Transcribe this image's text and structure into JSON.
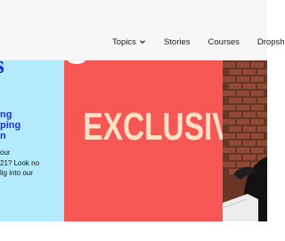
{
  "nav": {
    "items": [
      {
        "label": "Topics",
        "has_dropdown": true
      },
      {
        "label": "Stories"
      },
      {
        "label": "Courses"
      },
      {
        "label": "Dropshi"
      }
    ]
  },
  "cards": {
    "left": {
      "logo_glyph": "s",
      "headline_lines": [
        "ng",
        "ping",
        "n"
      ],
      "body_lines": [
        "our",
        "21? Look no",
        "lig into our"
      ]
    },
    "featured": {
      "label": "EXCLUSIVE"
    }
  },
  "colors": {
    "accent_blue": "#1c2fe6",
    "card_light_blue": "#b3ebfb",
    "card_red": "#f65754",
    "exclusive_text": "#ffe2c5"
  }
}
